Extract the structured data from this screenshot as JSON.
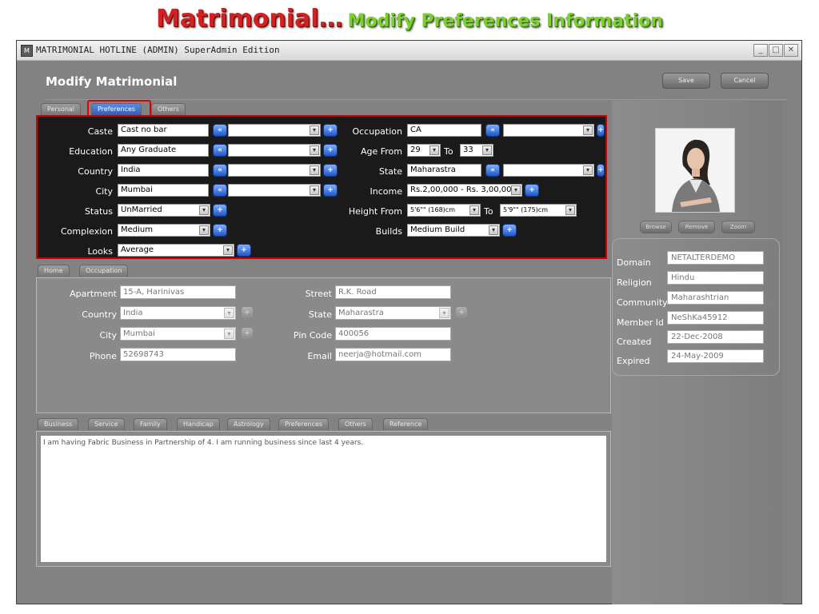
{
  "slide": {
    "title_red": "Matrimonial…",
    "title_green": "Modify Preferences Information"
  },
  "window": {
    "icon_text": "M",
    "title": "MATRIMONIAL HOTLINE (ADMIN) SuperAdmin Edition"
  },
  "header": {
    "title": "Modify Matrimonial",
    "save_label": "Save",
    "cancel_label": "Cancel"
  },
  "top_tabs": [
    "Personal",
    "Preferences",
    "Others"
  ],
  "preferences": {
    "caste": {
      "label": "Caste",
      "value": "Cast no bar"
    },
    "education": {
      "label": "Education",
      "value": "Any Graduate"
    },
    "country": {
      "label": "Country",
      "value": "India"
    },
    "city": {
      "label": "City",
      "value": "Mumbai"
    },
    "status": {
      "label": "Status",
      "value": "UnMarried"
    },
    "complexion": {
      "label": "Complexion",
      "value": "Medium"
    },
    "looks": {
      "label": "Looks",
      "value": "Average"
    },
    "occupation": {
      "label": "Occupation",
      "value": "CA"
    },
    "age": {
      "label": "Age From",
      "from": "29",
      "to_label": "To",
      "to": "33"
    },
    "state": {
      "label": "State",
      "value": "Maharastra"
    },
    "income": {
      "label": "Income",
      "value": "Rs.2,00,000 - Rs. 3,00,000"
    },
    "height": {
      "label": "Height From",
      "from": "5'6\"\" (168)cm",
      "to_label": "To",
      "to": "5'9\"\" (175)cm"
    },
    "builds": {
      "label": "Builds",
      "value": "Medium Build"
    }
  },
  "mid_tabs": [
    "Home",
    "Occupation"
  ],
  "home": {
    "apartment": {
      "label": "Apartment",
      "value": "15-A, Harinivas"
    },
    "country": {
      "label": "Country",
      "value": "India"
    },
    "city": {
      "label": "City",
      "value": "Mumbai"
    },
    "phone": {
      "label": "Phone",
      "value": "52698743"
    },
    "street": {
      "label": "Street",
      "value": "R.K. Road"
    },
    "state": {
      "label": "State",
      "value": "Maharastra"
    },
    "pincode": {
      "label": "Pin Code",
      "value": "400056"
    },
    "email": {
      "label": "Email",
      "value": "neerja@hotmail.com"
    }
  },
  "bottom_tabs": [
    "Business",
    "Service",
    "Family",
    "Handicap",
    "Astrology",
    "Preferences",
    "Others",
    "Reference"
  ],
  "business_text": "I am having Fabric Business in Partnership of 4. I am running business since last 4 years.",
  "photo_buttons": [
    "Browse",
    "Remove",
    "Zoom"
  ],
  "info": [
    {
      "label": "Domain",
      "value": "NETALTERDEMO"
    },
    {
      "label": "Religion",
      "value": "Hindu"
    },
    {
      "label": "Community",
      "value": "Maharashtrian"
    },
    {
      "label": "Member Id",
      "value": "NeShKa45912"
    },
    {
      "label": "Created",
      "value": "22-Dec-2008"
    },
    {
      "label": "Expired",
      "value": "24-May-2009"
    }
  ],
  "icons": {
    "back": "«",
    "plus": "+",
    "dropdown": "▾"
  },
  "colors": {
    "title_red": "#d42020",
    "title_green": "#7ad12e",
    "highlight": "#d00000",
    "active_tab": "#2e5fb8"
  }
}
